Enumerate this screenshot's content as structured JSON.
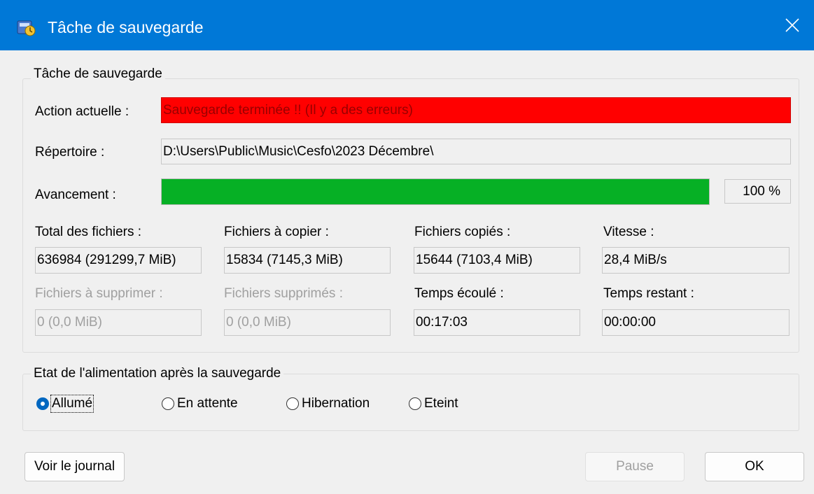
{
  "window": {
    "title": "Tâche de sauvegarde",
    "app_icon": "backup-app-icon",
    "close_icon": "close-icon"
  },
  "task_group": {
    "legend": "Tâche de sauvegarde",
    "action_label": "Action actuelle :",
    "action_value": "Sauvegarde terminée !! (Il y a des erreurs)",
    "directory_label": "Répertoire :",
    "directory_value": "D:\\Users\\Public\\Music\\Cesfo\\2023 Décembre\\",
    "progress_label": "Avancement :",
    "progress_fraction": 1.0,
    "progress_text": "100 %",
    "stats": {
      "total_label": "Total des fichiers :",
      "total_value": "636984 (291299,7 MiB)",
      "to_copy_label": "Fichiers à copier :",
      "to_copy_value": "15834 (7145,3 MiB)",
      "copied_label": "Fichiers copiés :",
      "copied_value": "15644 (7103,4 MiB)",
      "speed_label": "Vitesse :",
      "speed_value": "28,4 MiB/s",
      "to_delete_label": "Fichiers à supprimer :",
      "to_delete_value": "0 (0,0 MiB)",
      "deleted_label": "Fichiers supprimés :",
      "deleted_value": "0 (0,0 MiB)",
      "elapsed_label": "Temps écoulé :",
      "elapsed_value": "00:17:03",
      "remaining_label": "Temps restant :",
      "remaining_value": "00:00:00"
    }
  },
  "power_group": {
    "legend": "Etat de l'alimentation après la sauvegarde",
    "options": [
      {
        "label": "Allumé",
        "selected": true
      },
      {
        "label": "En attente",
        "selected": false
      },
      {
        "label": "Hibernation",
        "selected": false
      },
      {
        "label": "Eteint",
        "selected": false
      }
    ]
  },
  "buttons": {
    "log": "Voir le journal",
    "pause": "Pause",
    "ok": "OK"
  },
  "colors": {
    "titlebar": "#0078d7",
    "status_error_bg": "#ff0000",
    "progress_fill": "#06b025"
  }
}
